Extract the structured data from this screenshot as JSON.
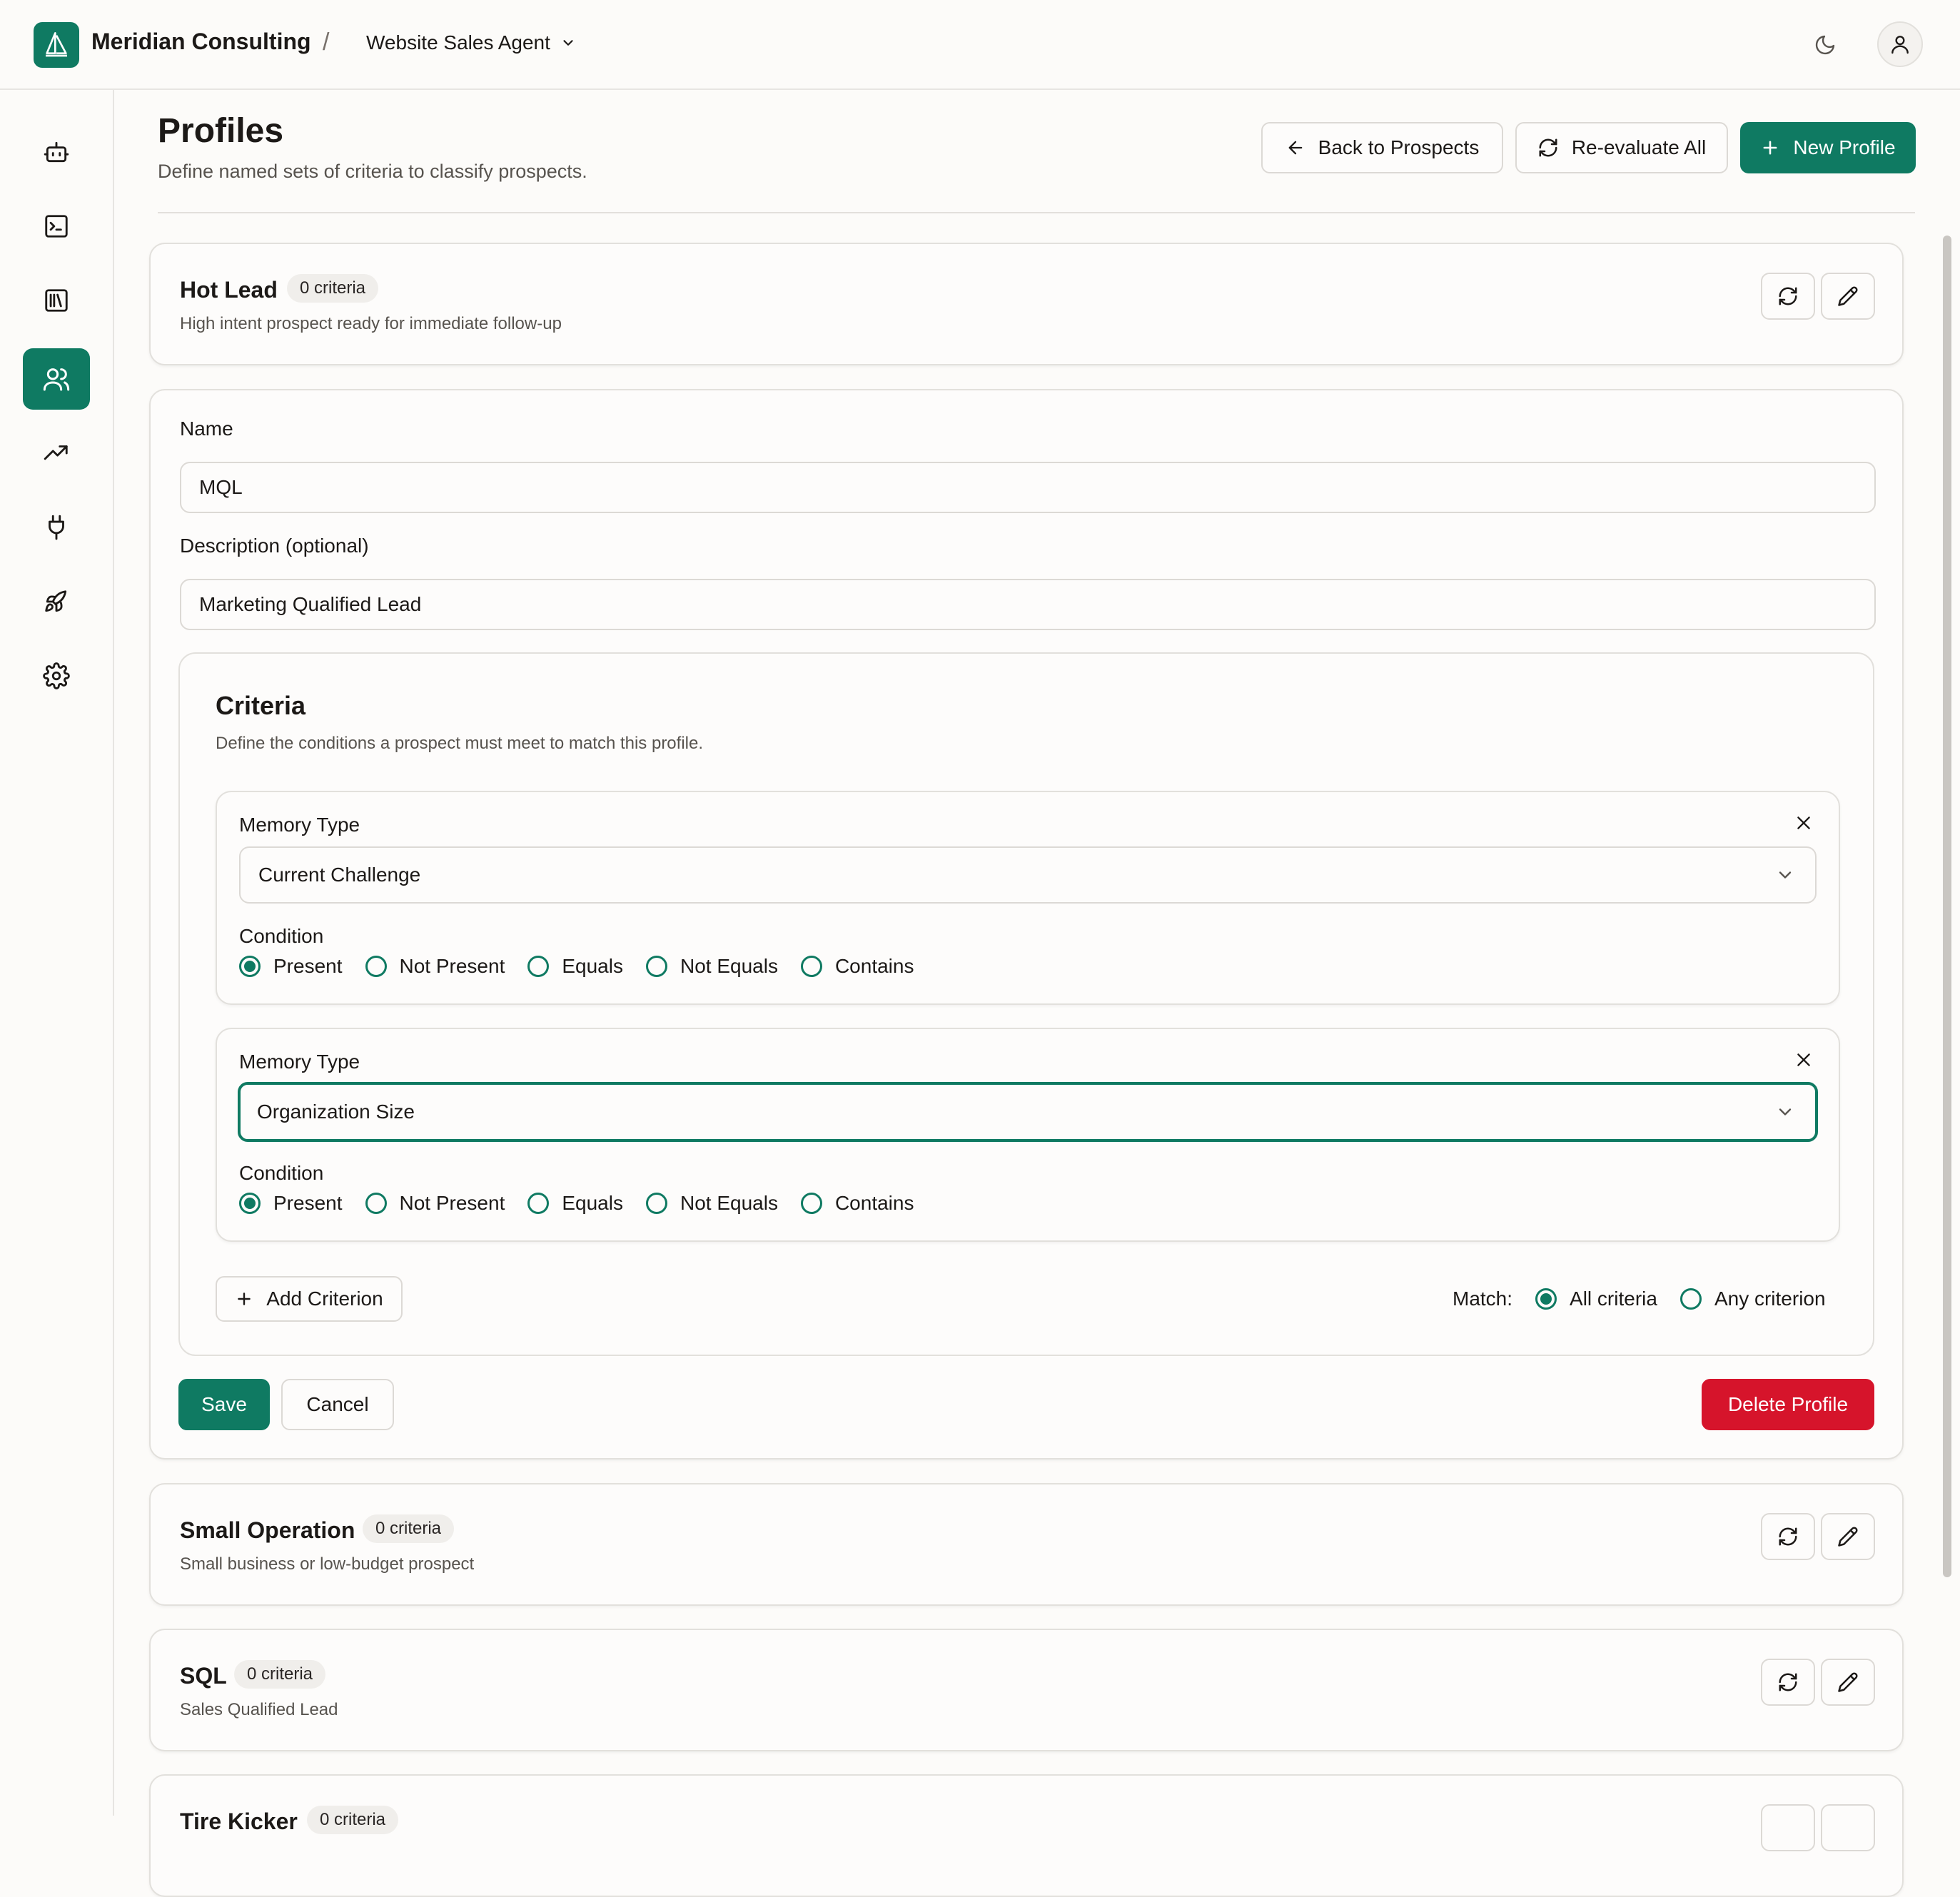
{
  "header": {
    "brand": "Meridian Consulting",
    "separator": "/",
    "agent_selector": "Website Sales Agent"
  },
  "sidebar": {
    "items": [
      {
        "icon": "bot-icon"
      },
      {
        "icon": "terminal-icon"
      },
      {
        "icon": "library-icon"
      },
      {
        "icon": "users-icon",
        "active": true
      },
      {
        "icon": "trending-up-icon"
      },
      {
        "icon": "plug-icon"
      },
      {
        "icon": "rocket-icon"
      },
      {
        "icon": "settings-icon"
      }
    ]
  },
  "page": {
    "title": "Profiles",
    "subtitle": "Define named sets of criteria to classify prospects.",
    "back_button": "Back to Prospects",
    "reevaluate_button": "Re-evaluate All",
    "new_button": "New Profile"
  },
  "profiles": [
    {
      "name": "Hot Lead",
      "badge": "0 criteria",
      "description": "High intent prospect ready for immediate follow-up"
    },
    {
      "name": "Small Operation",
      "badge": "0 criteria",
      "description": "Small business or low-budget prospect"
    },
    {
      "name": "SQL",
      "badge": "0 criteria",
      "description": "Sales Qualified Lead"
    },
    {
      "name": "Tire Kicker",
      "badge": "0 criteria",
      "description": ""
    }
  ],
  "editor": {
    "name_label": "Name",
    "name_value": "MQL",
    "description_label": "Description (optional)",
    "description_value": "Marketing Qualified Lead",
    "criteria_title": "Criteria",
    "criteria_subtitle": "Define the conditions a prospect must meet to match this profile.",
    "criteria": [
      {
        "memory_type_label": "Memory Type",
        "memory_type_value": "Current Challenge",
        "condition_label": "Condition",
        "selected": "Present"
      },
      {
        "memory_type_label": "Memory Type",
        "memory_type_value": "Organization Size",
        "condition_label": "Condition",
        "selected": "Present"
      }
    ],
    "condition_options": [
      "Present",
      "Not Present",
      "Equals",
      "Not Equals",
      "Contains"
    ],
    "add_criterion": "Add Criterion",
    "match_label": "Match:",
    "match_options": [
      "All criteria",
      "Any criterion"
    ],
    "match_selected": "All criteria",
    "save": "Save",
    "cancel": "Cancel",
    "delete": "Delete Profile"
  },
  "colors": {
    "accent": "#0f7a62",
    "danger": "#d6142b",
    "background": "#fcfbf9",
    "border": "#e2e0dc"
  }
}
